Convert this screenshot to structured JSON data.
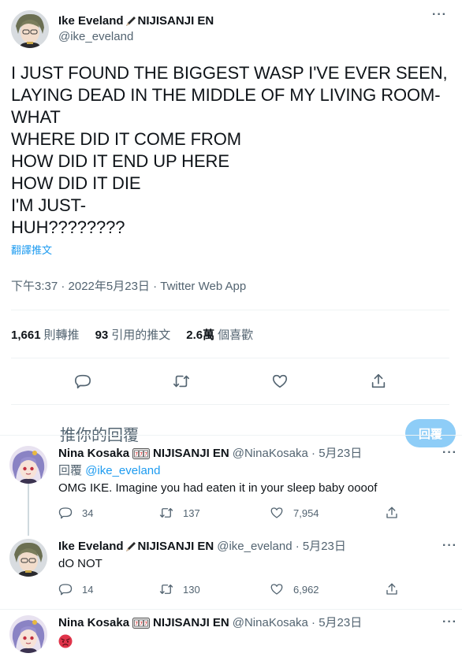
{
  "main_tweet": {
    "author_name": "Ike Eveland",
    "author_suffix": "NIJISANJI EN",
    "author_handle": "@ike_eveland",
    "text": "I JUST FOUND THE BIGGEST WASP I'VE EVER SEEN, LAYING DEAD IN THE MIDDLE OF MY LIVING ROOM-\nWHAT\nWHERE DID IT COME FROM\nHOW DID IT END UP HERE\nHOW DID IT DIE\nI'M JUST-\nHUH????????",
    "translate_label": "翻譯推文",
    "timestamp": "下午3:37 · 2022年5月23日 · Twitter Web App",
    "stats": {
      "retweets_value": "1,661",
      "retweets_label": "則轉推",
      "quotes_value": "93",
      "quotes_label": "引用的推文",
      "likes_value": "2.6萬",
      "likes_label": "個喜歡"
    }
  },
  "reply_box": {
    "placeholder": "推你的回覆",
    "button_label": "回覆"
  },
  "replies": [
    {
      "author_name": "Nina Kosaka",
      "author_suffix": "NIJISANJI EN",
      "meta": "@NinaKosaka · 5月23日",
      "replying_prefix": "回覆",
      "replying_to": "@ike_eveland",
      "text": "OMG IKE. Imagine you had eaten it in your sleep baby oooof",
      "replies_count": "34",
      "retweets_count": "137",
      "likes_count": "7,954"
    },
    {
      "author_name": "Ike Eveland",
      "author_suffix": "NIJISANJI EN",
      "meta": "@ike_eveland · 5月23日",
      "text": "dO NOT",
      "replies_count": "14",
      "retweets_count": "130",
      "likes_count": "6,962"
    },
    {
      "author_name": "Nina Kosaka",
      "author_suffix": "NIJISANJI EN",
      "meta": "@NinaKosaka · 5月23日",
      "text_emoji": "pouting-face-emoji"
    }
  ],
  "colors": {
    "accent": "#1d9bf0",
    "secondary_text": "#536471",
    "reply_button_disabled": "#8ecdf7"
  }
}
